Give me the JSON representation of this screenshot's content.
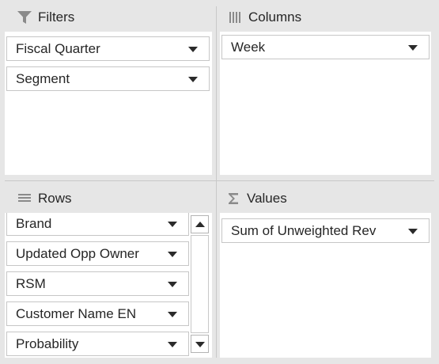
{
  "filters": {
    "title": "Filters",
    "icon": "filter-icon",
    "fields": [
      "Fiscal Quarter",
      "Segment"
    ]
  },
  "columns": {
    "title": "Columns",
    "icon": "columns-icon",
    "fields": [
      "Week"
    ]
  },
  "rows": {
    "title": "Rows",
    "icon": "rows-icon",
    "fields": [
      "Brand",
      "Updated Opp Owner",
      "RSM",
      "Customer Name EN",
      "Probability"
    ]
  },
  "values": {
    "title": "Values",
    "icon": "sigma-icon",
    "fields": [
      "Sum of Unweighted Rev"
    ]
  },
  "colors": {
    "background": "#e6e6e6",
    "box": "#ffffff",
    "border": "#c6c6c6",
    "text": "#262626"
  }
}
